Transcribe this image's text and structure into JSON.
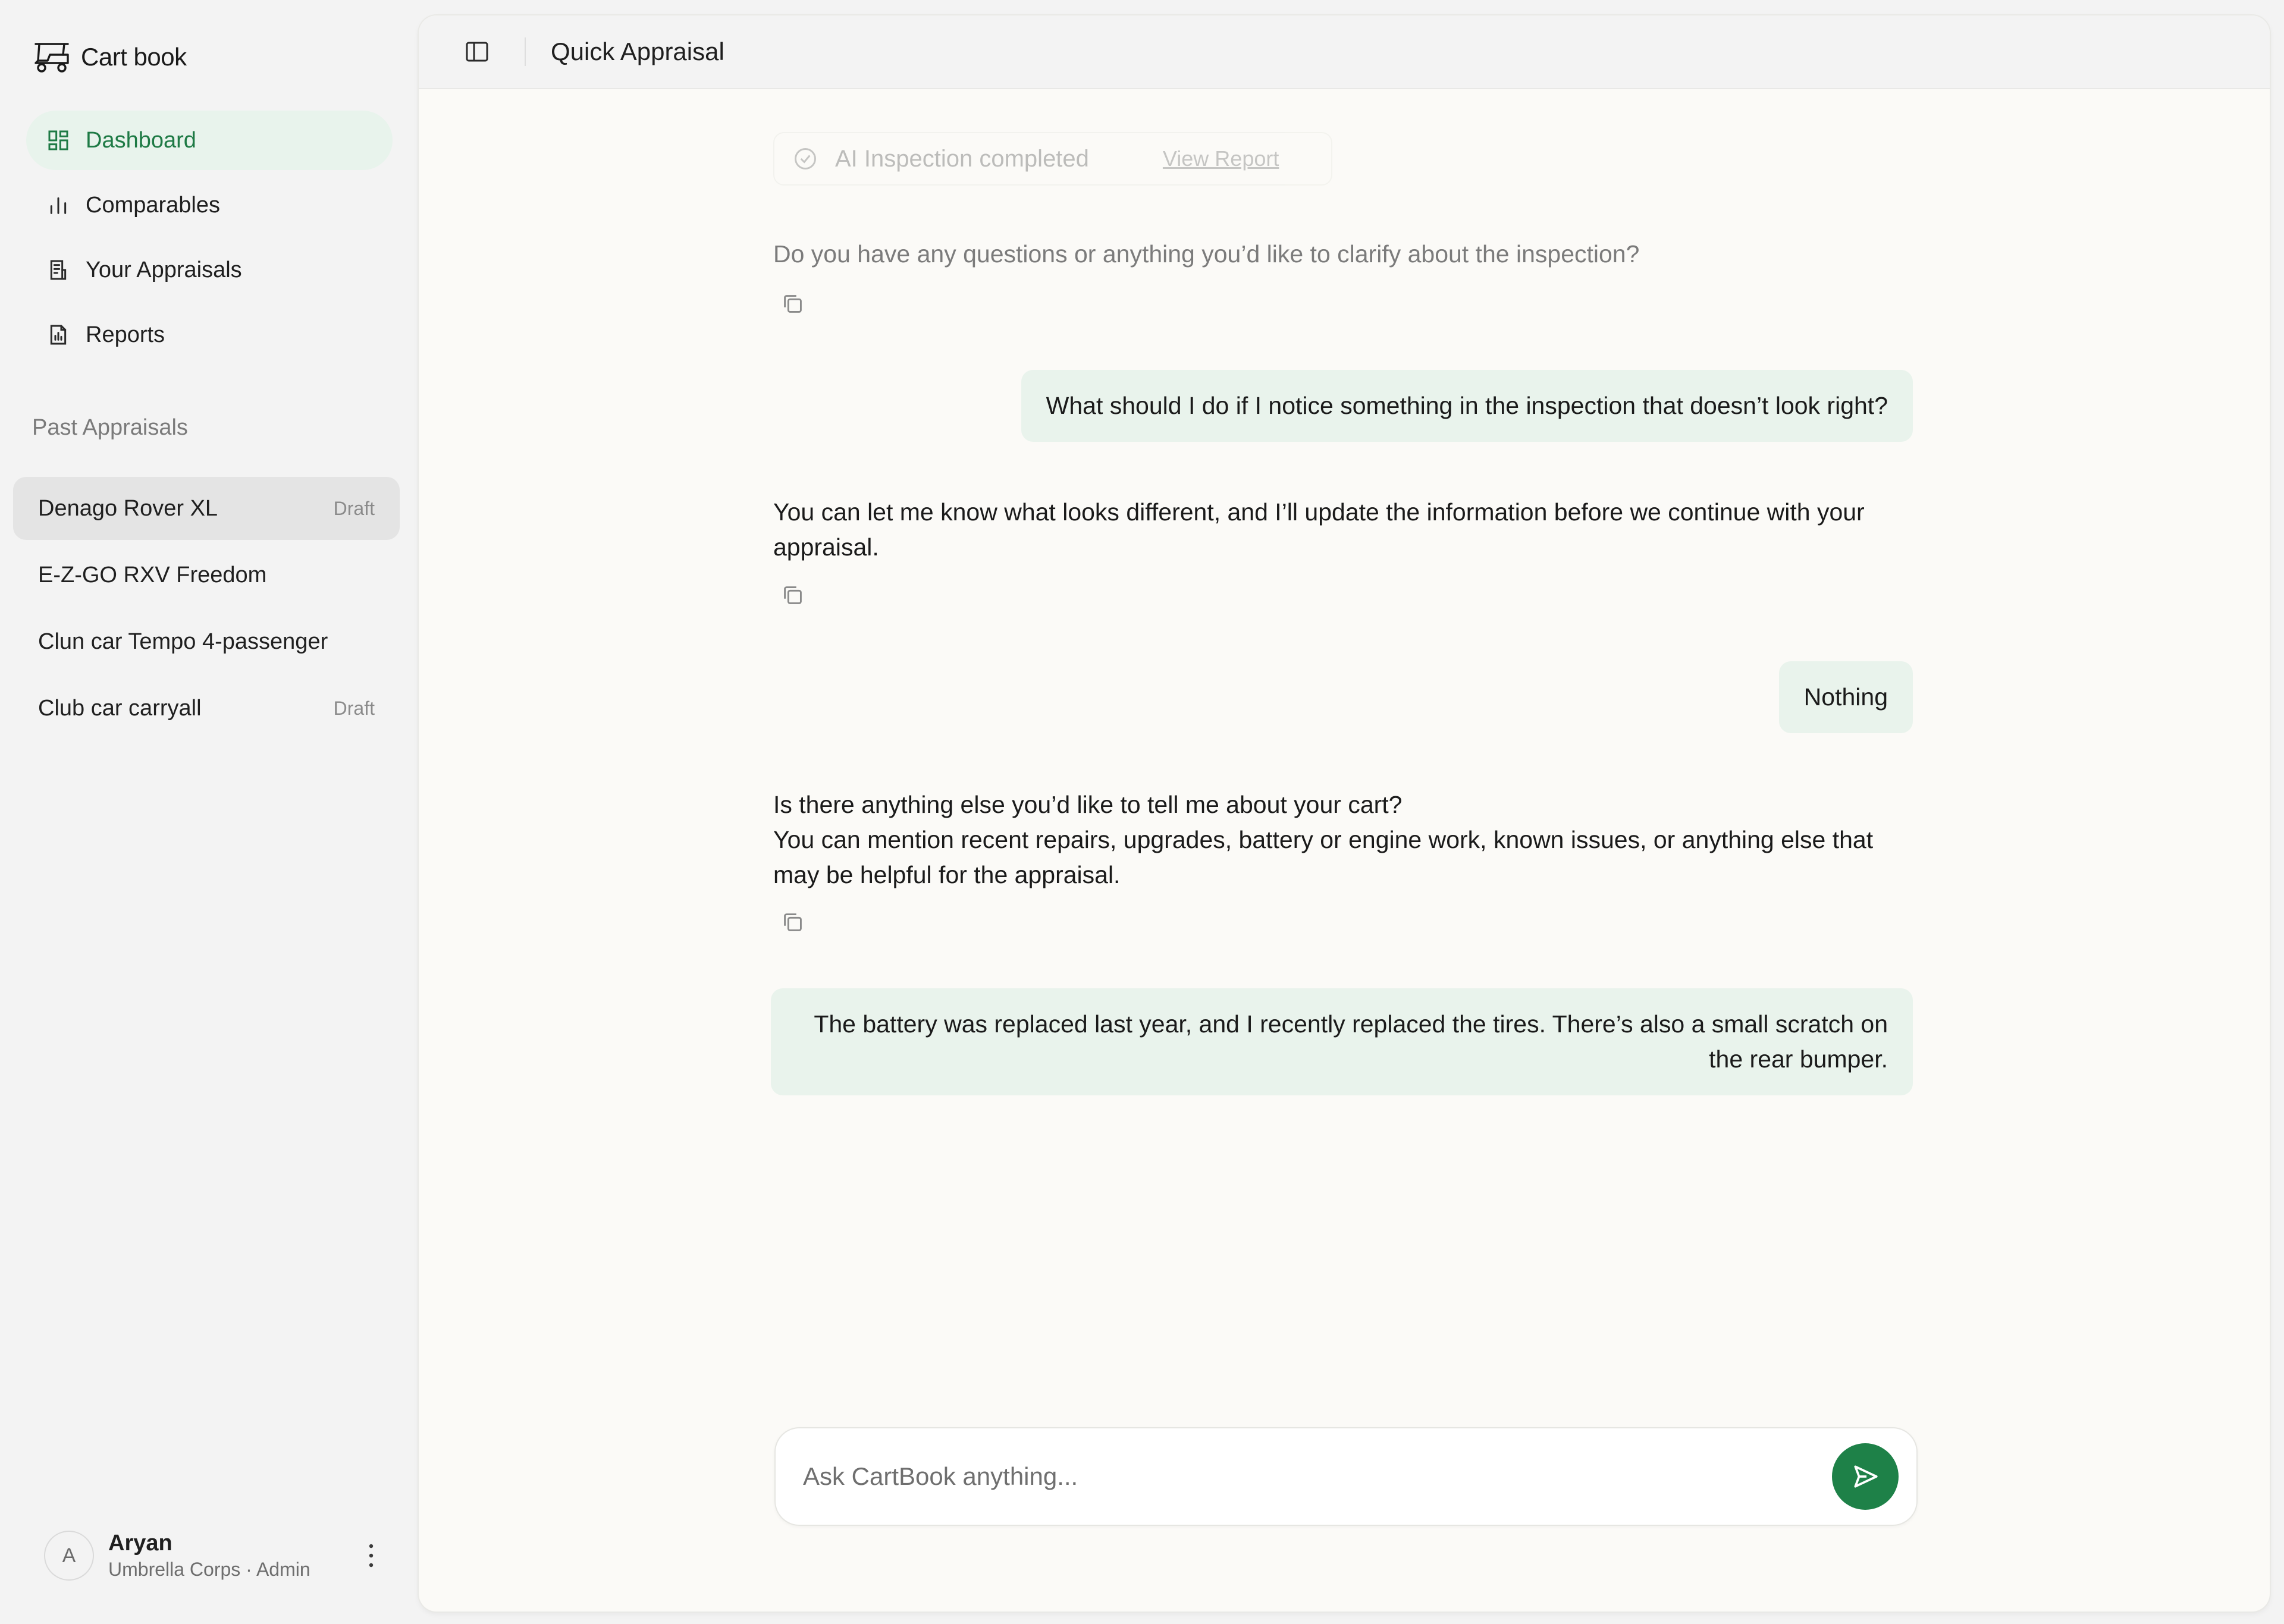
{
  "brand": {
    "name": "Cart book",
    "icon": "golf-cart-icon"
  },
  "nav": [
    {
      "label": "Dashboard",
      "icon": "dashboard-icon",
      "active": true
    },
    {
      "label": "Comparables",
      "icon": "bar-chart-icon",
      "active": false
    },
    {
      "label": "Your Appraisals",
      "icon": "document-list-icon",
      "active": false
    },
    {
      "label": "Reports",
      "icon": "report-icon",
      "active": false
    }
  ],
  "past": {
    "title": "Past Appraisals",
    "items": [
      {
        "name": "Denago Rover XL",
        "badge": "Draft",
        "selected": true
      },
      {
        "name": "E-Z-GO RXV Freedom",
        "badge": "",
        "selected": false
      },
      {
        "name": "Clun car Tempo 4-passenger",
        "badge": "",
        "selected": false
      },
      {
        "name": "Club car carryall",
        "badge": "Draft",
        "selected": false
      }
    ]
  },
  "user": {
    "initial": "A",
    "name": "Aryan",
    "role": "Umbrella Corps · Admin"
  },
  "header": {
    "title": "Quick Appraisal"
  },
  "chat": {
    "inspection": {
      "text": "AI Inspection completed",
      "link": "View Report"
    },
    "assistant_1": "Do you have any questions or anything you’d like to clarify about the inspection?",
    "user_1": "What should I do if I notice something in the inspection that doesn’t look right?",
    "assistant_2": "You can let me know what looks different, and I’ll update the information before we continue with your appraisal.",
    "user_2": "Nothing",
    "assistant_3a": "Is there anything else you’d like to tell me about your cart?",
    "assistant_3b": "You can mention recent repairs, upgrades, battery or engine work, known issues, or anything else that may be helpful for the appraisal.",
    "user_3": "The battery was replaced last year, and I recently replaced the tires. There’s also a small scratch on the rear bumper."
  },
  "composer": {
    "placeholder": "Ask CartBook anything..."
  },
  "colors": {
    "accent": "#1e8148",
    "accent_soft": "#e9f3ec",
    "active_nav_bg": "#e8f3ec",
    "active_nav_text": "#1e7a45"
  }
}
